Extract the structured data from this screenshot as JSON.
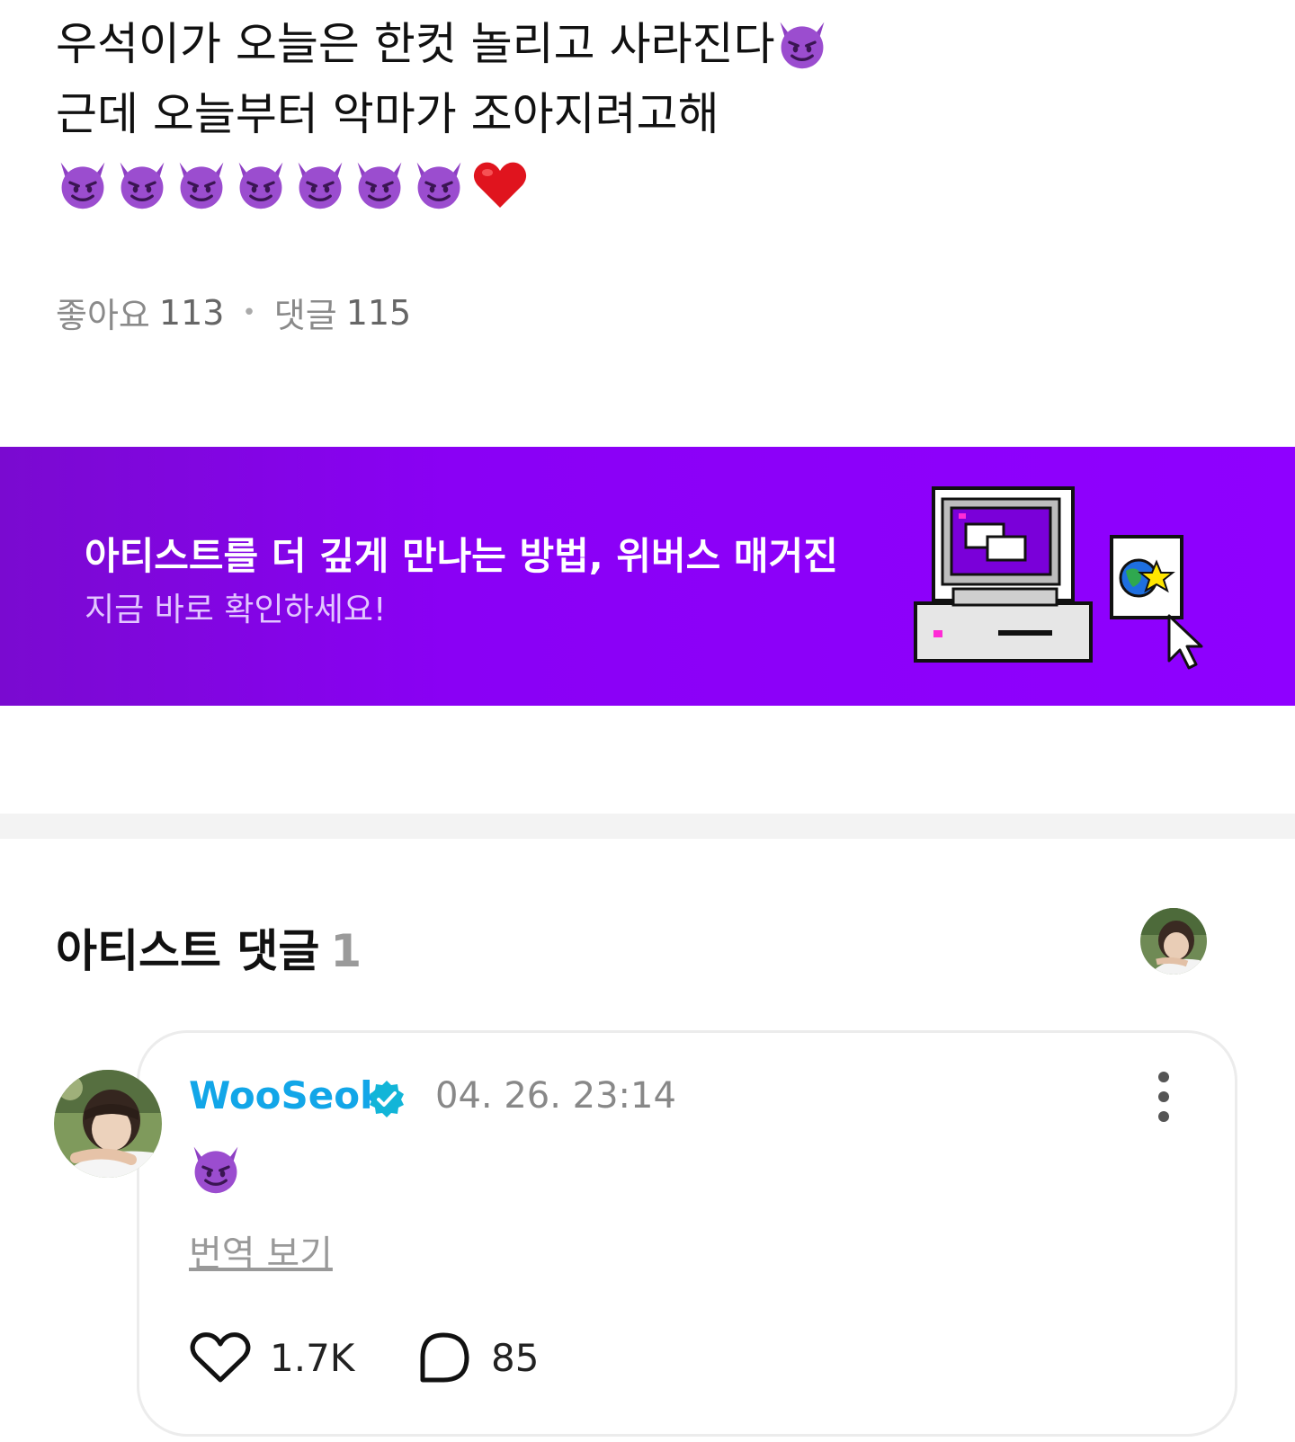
{
  "post": {
    "line1": "우석이가 오늘은 한컷 놀리고 사라진다",
    "line2": "근데 오늘부터 악마가 조아지려고해",
    "emoji_line": [
      "smiling-devil-icon",
      "smiling-devil-icon",
      "smiling-devil-icon",
      "smiling-devil-icon",
      "smiling-devil-icon",
      "smiling-devil-icon",
      "smiling-devil-icon",
      "red-heart-icon"
    ]
  },
  "stats": {
    "likes_label": "좋아요",
    "likes_count": "113",
    "comments_label": "댓글",
    "comments_count": "115"
  },
  "banner": {
    "title": "아티스트를 더 깊게 만나는 방법, 위버스 매거진",
    "subtitle": "지금 바로 확인하세요!",
    "accent": "#8f00ff"
  },
  "artist_comments": {
    "title": "아티스트 댓글",
    "count": "1"
  },
  "comment": {
    "author": "WooSeok",
    "timestamp": "04. 26. 23:14",
    "translate_label": "번역 보기",
    "like_count": "1.7K",
    "reply_count": "85",
    "author_color": "#12a6e8"
  }
}
